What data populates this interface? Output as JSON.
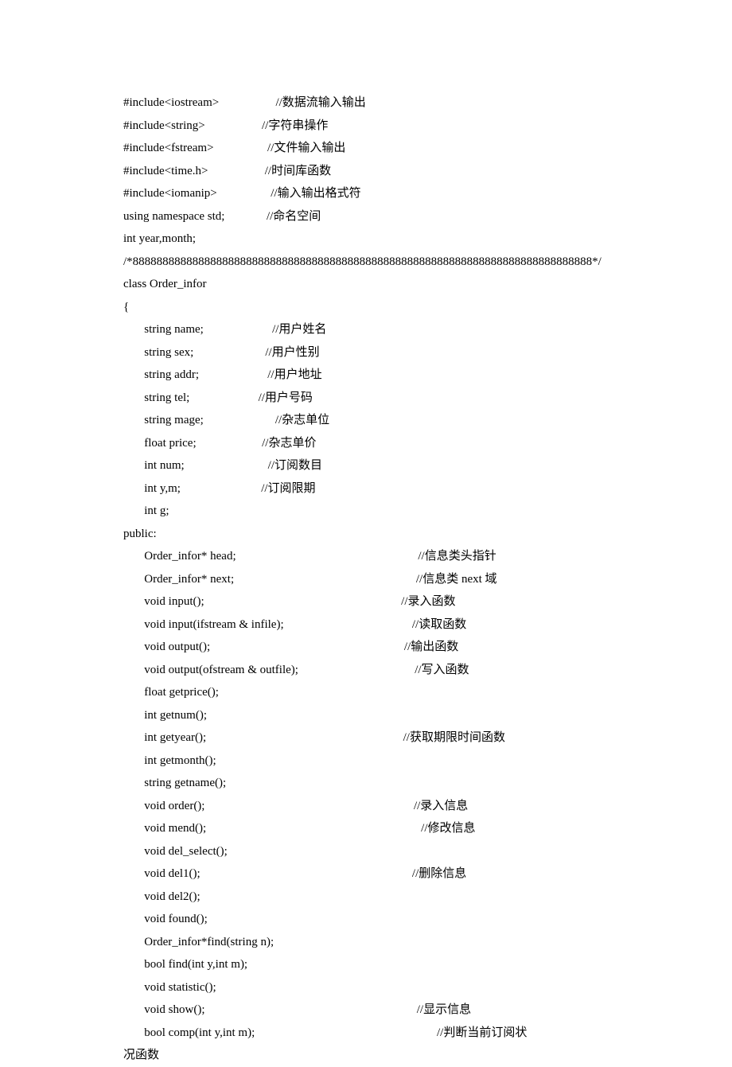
{
  "lines": [
    "#include<iostream>                   //数据流输入输出",
    "#include<string>                   //字符串操作",
    "#include<fstream>                  //文件输入输出",
    "#include<time.h>                   //时间库函数",
    "#include<iomanip>                  //输入输出格式符",
    "using namespace std;              //命名空间",
    "int year,month;",
    "/*88888888888888888888888888888888888888888888888888888888888888888888888888888*/",
    "class Order_infor",
    "{",
    "       string name;                       //用户姓名",
    "       string sex;                        //用户性别",
    "       string addr;                       //用户地址",
    "       string tel;                       //用户号码",
    "       string mage;                        //杂志单位",
    "       float price;                      //杂志单价",
    "       int num;                            //订阅数目",
    "       int y,m;                           //订阅限期",
    "       int g;",
    "public:",
    "       Order_infor* head;                                                             //信息类头指针",
    "       Order_infor* next;                                                             //信息类 next 域",
    "",
    "       void input();                                                                  //录入函数",
    "       void input(ifstream & infile);                                           //读取函数",
    "       void output();                                                                 //输出函数",
    "       void output(ofstream & outfile);                                       //写入函数",
    "       float getprice();",
    "       int getnum();",
    "       int getyear();                                                                  //获取期限时间函数",
    "       int getmonth();",
    "       string getname();",
    "       void order();                                                                      //录入信息",
    "       void mend();                                                                        //修改信息",
    "       void del_select();",
    "       void del1();                                                                       //删除信息",
    "       void del2();",
    "       void found();",
    "       Order_infor*find(string n);",
    "       bool find(int y,int m);",
    "       void statistic();",
    "       void show();                                                                       //显示信息",
    "       bool comp(int y,int m);                                                             //判断当前订阅状",
    "况函数"
  ]
}
